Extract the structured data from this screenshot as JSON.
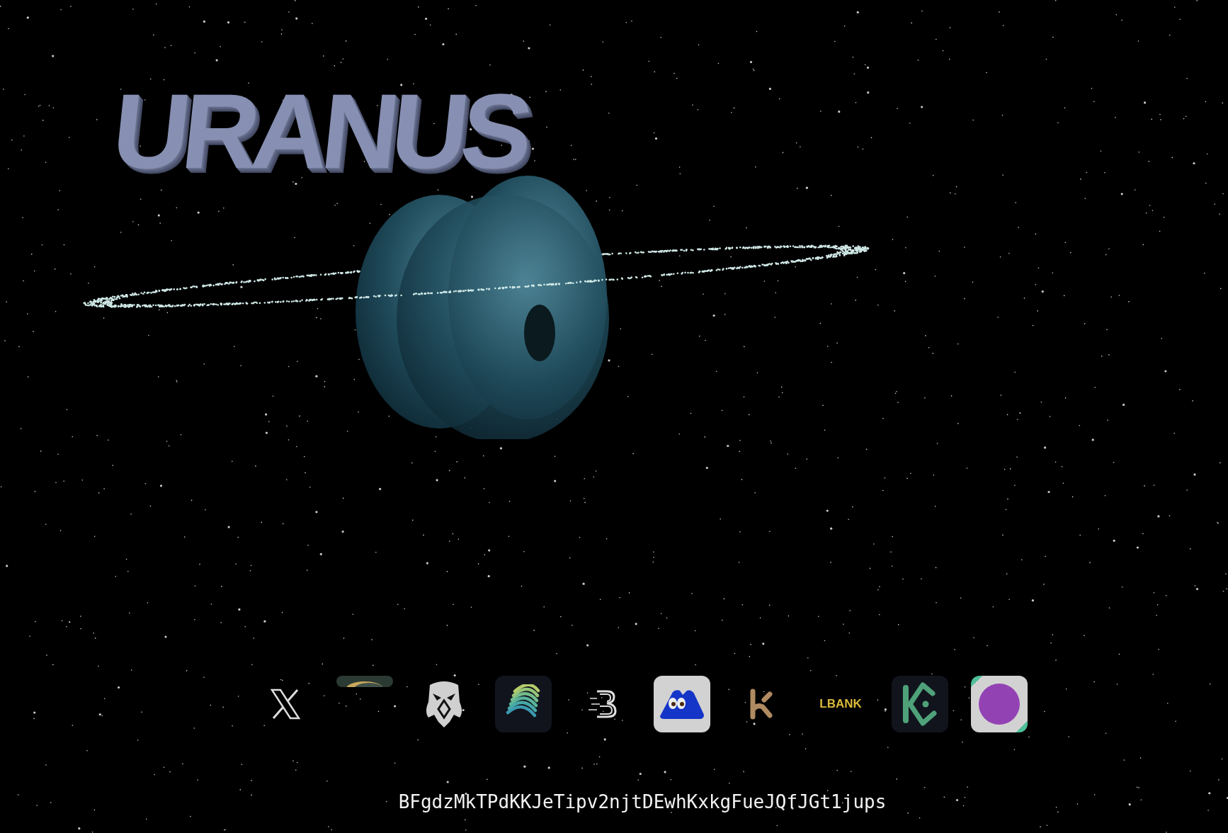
{
  "title": "URANUS",
  "links": [
    {
      "kind": "x"
    },
    {
      "kind": "banner"
    },
    {
      "kind": "eagle"
    },
    {
      "kind": "globe"
    },
    {
      "kind": "b"
    },
    {
      "kind": "monster"
    },
    {
      "kind": "k"
    },
    {
      "kind": "wordmark",
      "label": "LBANK"
    },
    {
      "kind": "kucoin"
    },
    {
      "kind": "circle"
    }
  ],
  "address": "BFgdzMkTPdKKJeTipv2njtDEwhKxkgFueJQfJGt1jups"
}
